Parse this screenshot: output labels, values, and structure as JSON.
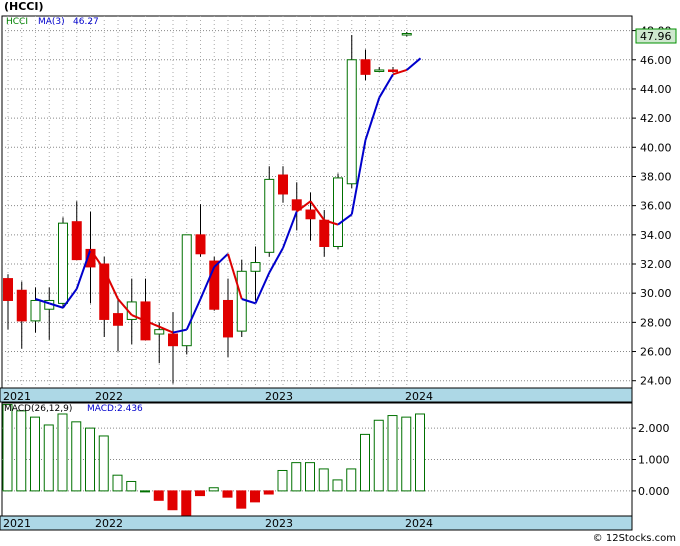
{
  "header": {
    "title": "(HCCI)"
  },
  "footer": {
    "credit": "© 12Stocks.com"
  },
  "chart_data": [
    {
      "type": "candlestick",
      "ticker": "HCCI",
      "ma_label": "MA(3)",
      "ma_value": "46.27",
      "last_price": "47.96",
      "ylim": [
        23.5,
        49
      ],
      "yticks": [
        "48.00",
        "46.00",
        "44.00",
        "42.00",
        "40.00",
        "38.00",
        "36.00",
        "34.00",
        "32.00",
        "30.00",
        "28.00",
        "26.00",
        "24.00"
      ],
      "xticks": [
        "2021",
        "2022",
        "2023",
        "2024"
      ],
      "candles": [
        {
          "o": 31.0,
          "h": 31.3,
          "l": 27.5,
          "c": 29.5
        },
        {
          "o": 30.2,
          "h": 30.8,
          "l": 26.2,
          "c": 28.1
        },
        {
          "o": 28.1,
          "h": 30.4,
          "l": 27.3,
          "c": 29.5
        },
        {
          "o": 28.9,
          "h": 30.4,
          "l": 26.8,
          "c": 29.5
        },
        {
          "o": 29.3,
          "h": 35.2,
          "l": 29.0,
          "c": 34.8
        },
        {
          "o": 34.9,
          "h": 36.3,
          "l": 33.3,
          "c": 32.3
        },
        {
          "o": 33.0,
          "h": 35.6,
          "l": 29.3,
          "c": 31.8
        },
        {
          "o": 32.0,
          "h": 32.5,
          "l": 27.0,
          "c": 28.2
        },
        {
          "o": 28.6,
          "h": 29.7,
          "l": 26.0,
          "c": 27.8
        },
        {
          "o": 28.2,
          "h": 31.0,
          "l": 26.5,
          "c": 29.4
        },
        {
          "o": 29.4,
          "h": 31.0,
          "l": 26.8,
          "c": 26.8
        },
        {
          "o": 27.2,
          "h": 28.0,
          "l": 25.2,
          "c": 27.5
        },
        {
          "o": 27.2,
          "h": 28.7,
          "l": 23.8,
          "c": 26.4
        },
        {
          "o": 26.4,
          "h": 34.0,
          "l": 25.8,
          "c": 34.0
        },
        {
          "o": 34.0,
          "h": 36.1,
          "l": 32.5,
          "c": 32.7
        },
        {
          "o": 32.2,
          "h": 32.5,
          "l": 28.8,
          "c": 28.9
        },
        {
          "o": 29.5,
          "h": 31.0,
          "l": 25.6,
          "c": 27.0
        },
        {
          "o": 27.4,
          "h": 32.3,
          "l": 27.0,
          "c": 31.5
        },
        {
          "o": 31.5,
          "h": 33.2,
          "l": 29.5,
          "c": 32.1
        },
        {
          "o": 32.8,
          "h": 38.7,
          "l": 32.5,
          "c": 37.8
        },
        {
          "o": 38.1,
          "h": 38.7,
          "l": 36.2,
          "c": 36.8
        },
        {
          "o": 36.4,
          "h": 37.6,
          "l": 34.3,
          "c": 35.7
        },
        {
          "o": 35.7,
          "h": 36.9,
          "l": 33.6,
          "c": 35.1
        },
        {
          "o": 35.0,
          "h": 35.7,
          "l": 32.5,
          "c": 33.2
        },
        {
          "o": 33.2,
          "h": 38.2,
          "l": 33.0,
          "c": 37.9
        },
        {
          "o": 37.5,
          "h": 47.7,
          "l": 37.2,
          "c": 46.0
        },
        {
          "o": 46.0,
          "h": 46.7,
          "l": 44.6,
          "c": 45.0
        },
        {
          "o": 45.2,
          "h": 45.5,
          "l": 45.2,
          "c": 45.3
        },
        {
          "o": 45.3,
          "h": 45.5,
          "l": 45.1,
          "c": 45.2
        },
        {
          "o": 47.7,
          "h": 47.9,
          "l": 47.6,
          "c": 47.8
        }
      ],
      "ma": [
        null,
        null,
        29.6,
        29.3,
        29.0,
        30.3,
        33.0,
        31.6,
        29.6,
        28.5,
        28.1,
        27.7,
        27.3,
        27.5,
        29.6,
        31.8,
        32.7,
        29.6,
        29.3,
        31.4,
        33.1,
        35.6,
        36.3,
        35.0,
        34.7,
        35.4,
        40.5,
        43.4,
        45.0,
        45.3,
        46.1
      ],
      "ma_colors": [
        "#0000cc",
        "#0000cc",
        "#0000cc",
        "#0000cc",
        "#0000cc",
        "#0000cc",
        "#dd0000",
        "#dd0000",
        "#dd0000",
        "#dd0000",
        "#dd0000",
        "#dd0000",
        "#0000cc",
        "#0000cc",
        "#0000cc",
        "#0000cc",
        "#dd0000",
        "#0000cc",
        "#0000cc",
        "#0000cc",
        "#0000cc",
        "#dd0000",
        "#dd0000",
        "#dd0000",
        "#0000cc",
        "#0000cc",
        "#0000cc",
        "#0000cc",
        "#dd0000",
        "#0000cc"
      ]
    },
    {
      "type": "bar",
      "name": "MACD",
      "label": "MACD(26,12,9)",
      "value_label": "MACD:2.436",
      "ylim": [
        -0.8,
        2.8
      ],
      "yticks": [
        "2.000",
        "1.000",
        "0.000"
      ],
      "xticks": [
        "2021",
        "2022",
        "2023",
        "2024"
      ],
      "values": [
        2.75,
        2.55,
        2.35,
        2.1,
        2.45,
        2.2,
        2.0,
        1.75,
        0.5,
        0.3,
        0.0,
        -0.3,
        -0.6,
        -0.8,
        -0.15,
        0.1,
        -0.2,
        -0.55,
        -0.35,
        -0.1,
        0.65,
        0.9,
        0.9,
        0.7,
        0.35,
        0.7,
        1.8,
        2.25,
        2.4,
        2.35,
        2.45
      ]
    }
  ]
}
